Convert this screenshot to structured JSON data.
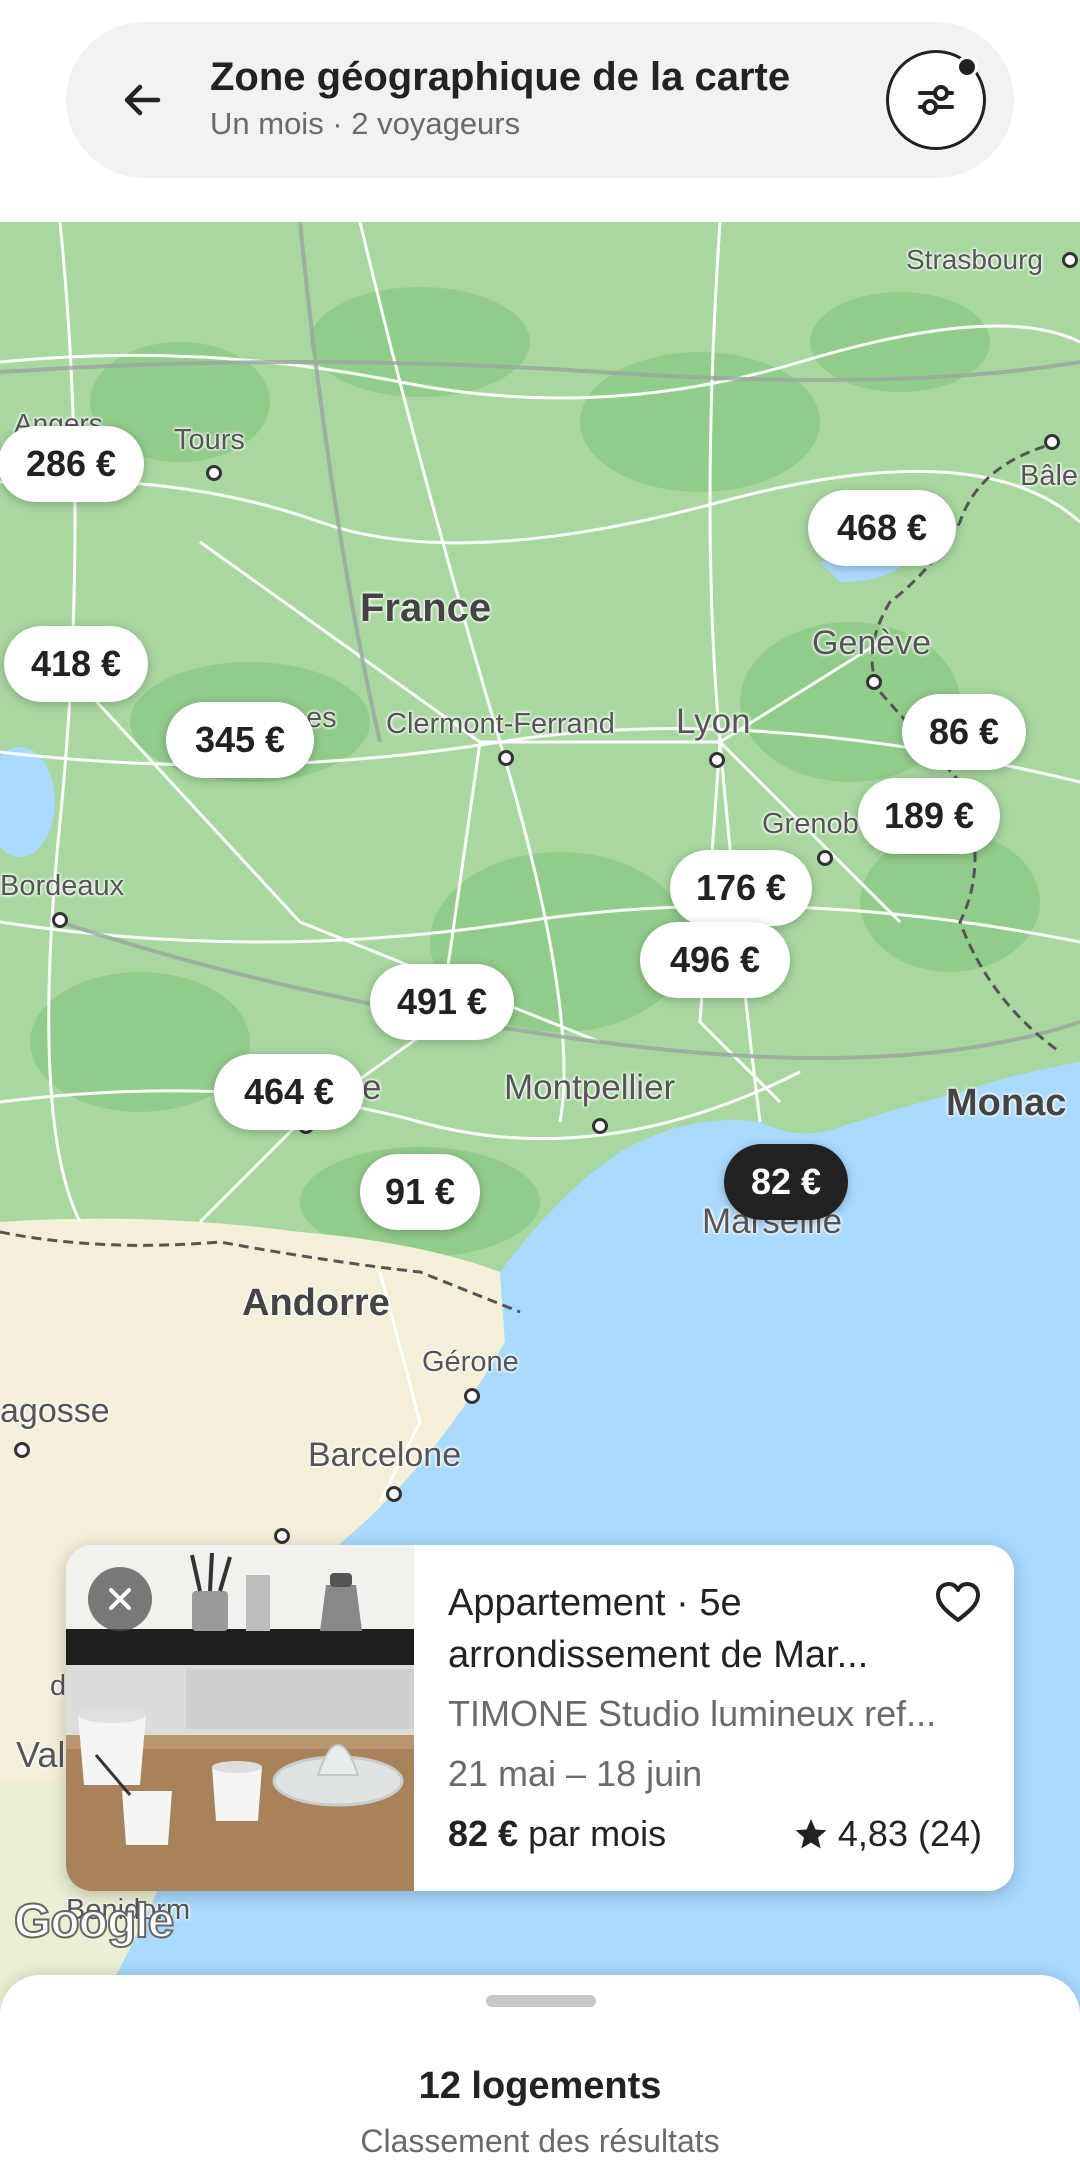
{
  "header": {
    "title": "Zone géographique de la carte",
    "subtitle": "Un mois · 2 voyageurs"
  },
  "map": {
    "labels": {
      "strasbourg": "Strasbourg",
      "angers": "Angers",
      "tours": "Tours",
      "bale": "Bâle",
      "france": "France",
      "geneve": "Genève",
      "clermont": "Clermont-Ferrand",
      "lyon": "Lyon",
      "nantes_frag": "es",
      "grenoble": "Grenob",
      "bordeaux": "Bordeaux",
      "montpellier": "Montpellier",
      "monaco": "Monac",
      "toulouse_frag": "e",
      "marseille": "Marseille",
      "andorre": "Andorre",
      "gerone": "Gérone",
      "saragosse": "agosse",
      "barcelone": "Barcelone",
      "valence": "Val",
      "benidorm": "Benidorm",
      "d_frag": "d"
    },
    "prices": [
      {
        "id": "p286",
        "label": "286 €",
        "selected": false
      },
      {
        "id": "p468",
        "label": "468 €",
        "selected": false
      },
      {
        "id": "p418",
        "label": "418 €",
        "selected": false
      },
      {
        "id": "p345",
        "label": "345 €",
        "selected": false
      },
      {
        "id": "p86",
        "label": "86 €",
        "selected": false
      },
      {
        "id": "p189",
        "label": "189 €",
        "selected": false
      },
      {
        "id": "p176",
        "label": "176 €",
        "selected": false
      },
      {
        "id": "p496",
        "label": "496 €",
        "selected": false
      },
      {
        "id": "p491",
        "label": "491 €",
        "selected": false
      },
      {
        "id": "p464",
        "label": "464 €",
        "selected": false
      },
      {
        "id": "p91",
        "label": "91 €",
        "selected": false
      },
      {
        "id": "p82",
        "label": "82 €",
        "selected": true
      }
    ],
    "attribution": "Google"
  },
  "card": {
    "title_line1": "Appartement · 5e",
    "title_line2": "arrondissement de Mar...",
    "description": "TIMONE Studio lumineux ref...",
    "dates": "21 mai – 18 juin",
    "price_amount": "82 €",
    "price_period": "par mois",
    "rating": "4,83 (24)"
  },
  "sheet": {
    "count": "12 logements",
    "sort": "Classement des résultats"
  },
  "colors": {
    "land": "#a8d8a0",
    "sea": "#aadaff",
    "selected_pin": "#222222"
  }
}
